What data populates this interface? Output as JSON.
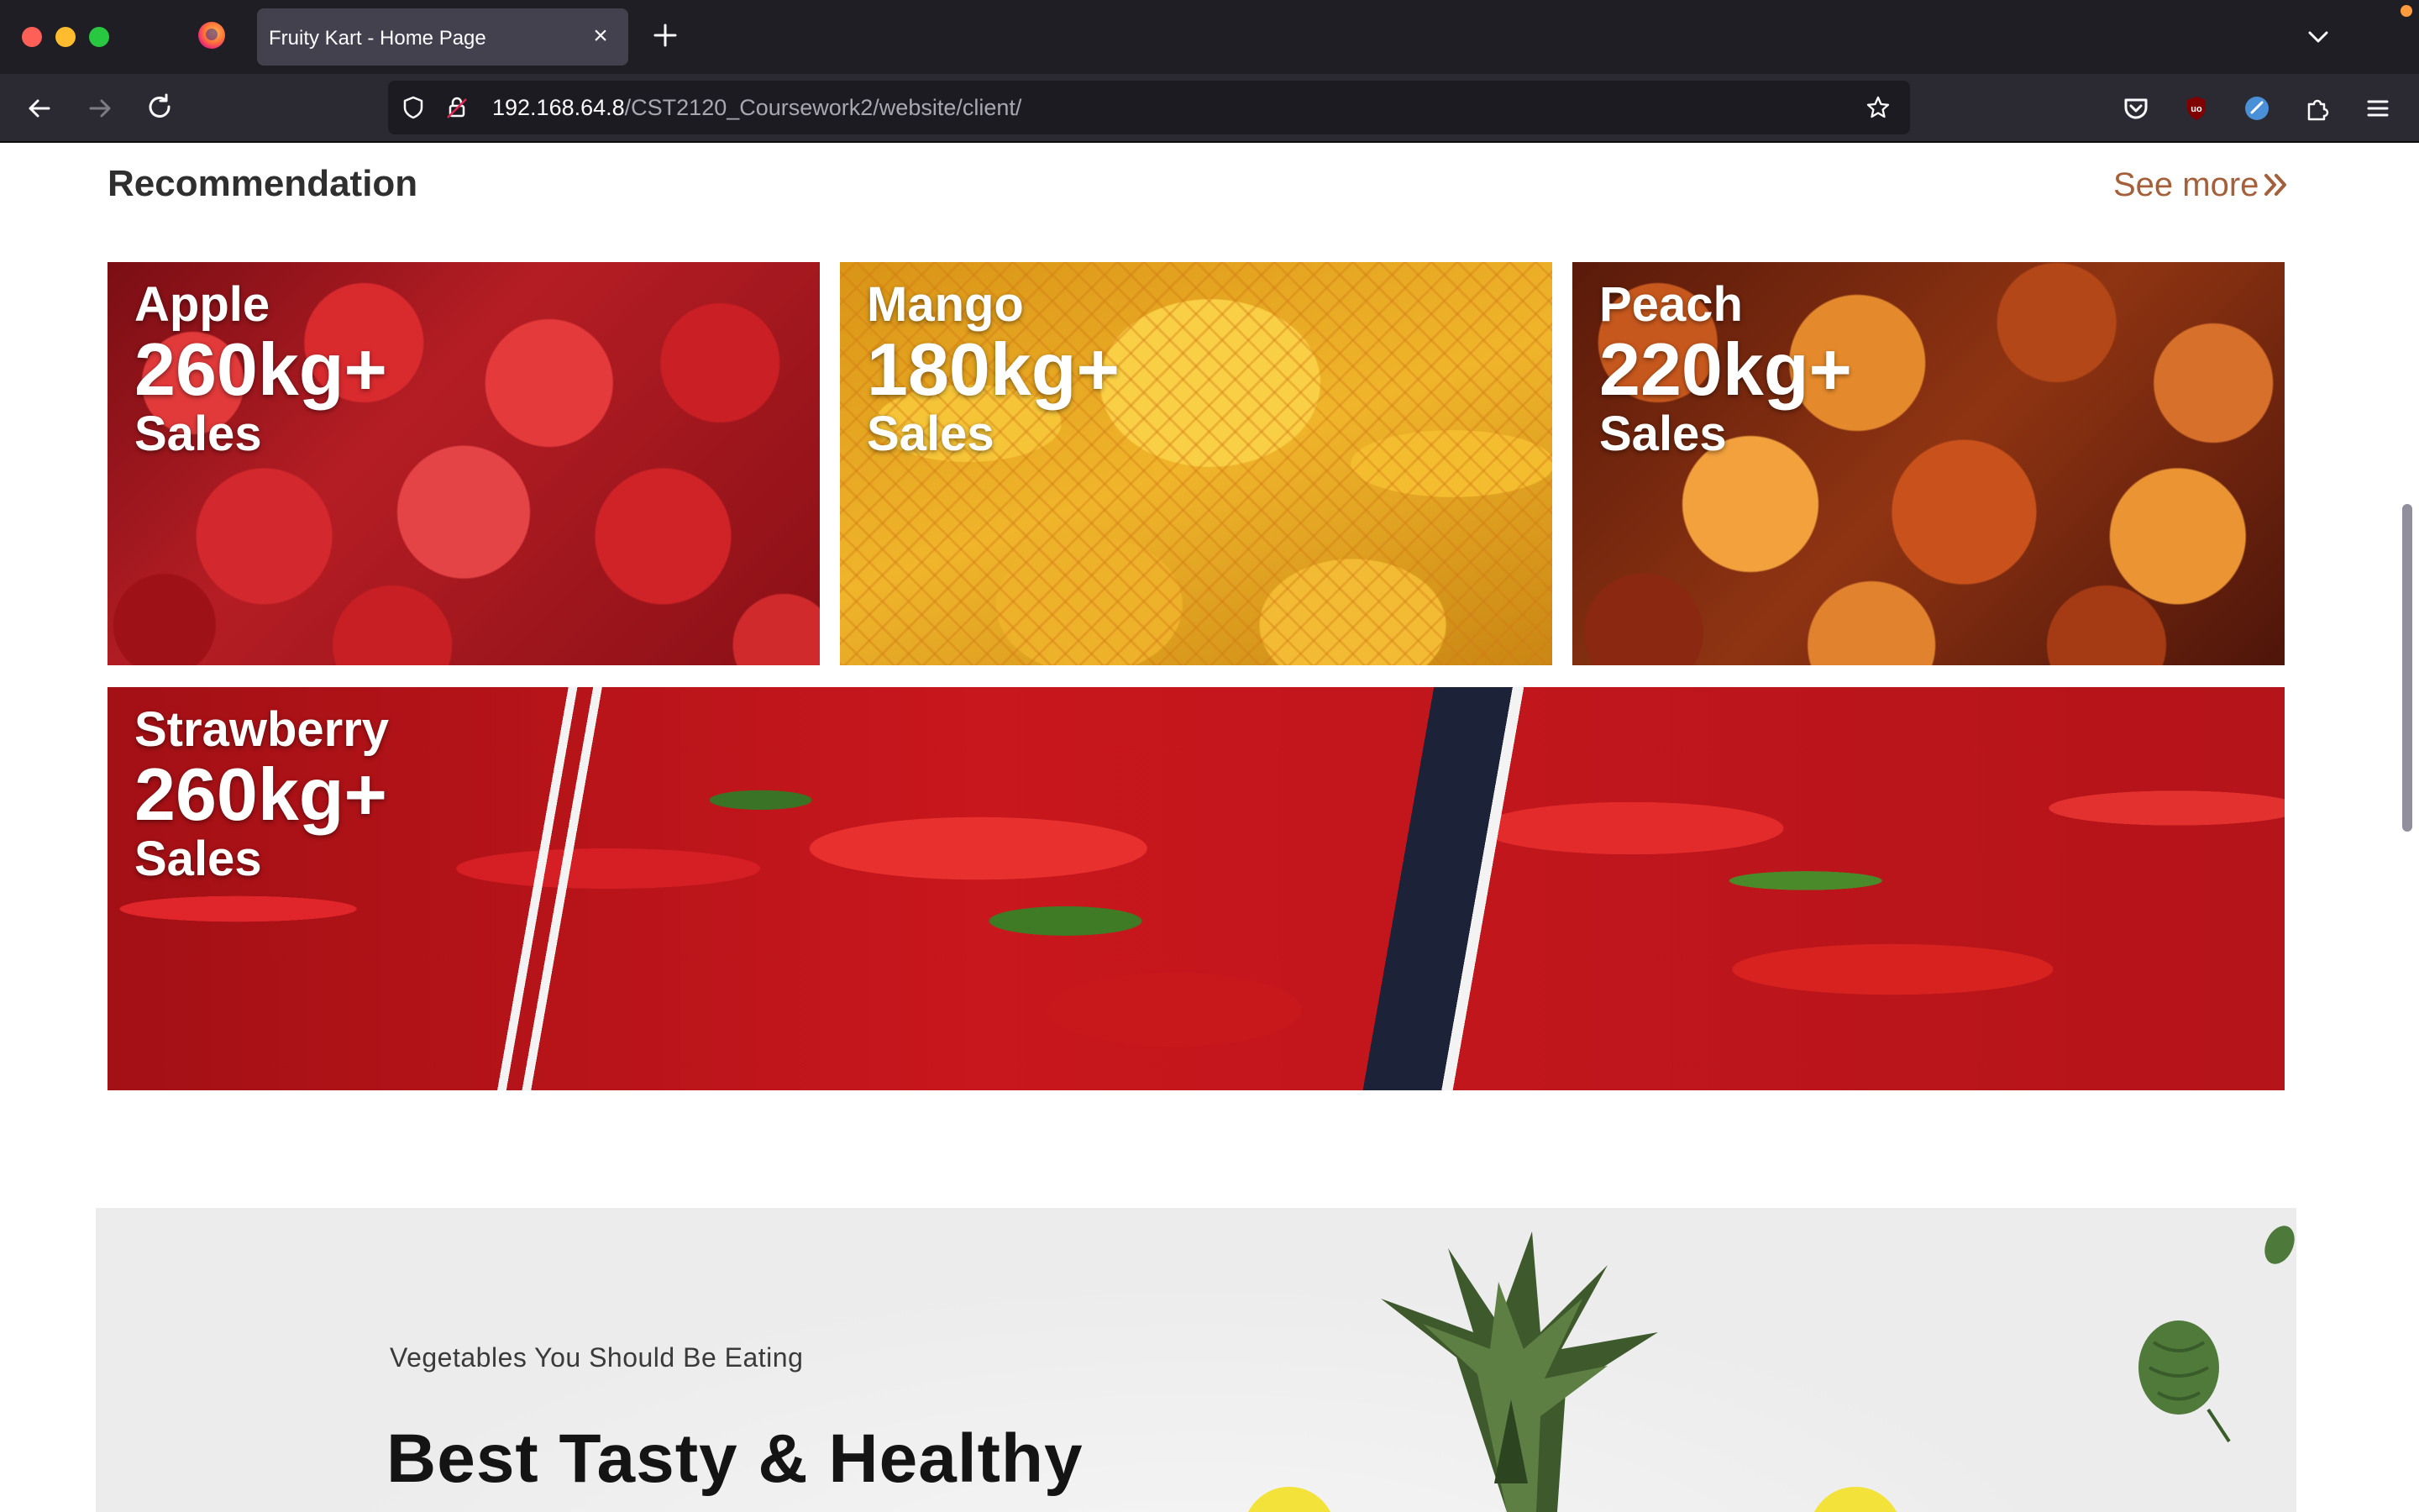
{
  "browser": {
    "tab_title": "Fruity Kart - Home Page",
    "url_host": "192.168.64.8",
    "url_path": "/CST2120_Coursework2/website/client/",
    "icons": [
      "firefox-icon",
      "close-icon",
      "plus-icon",
      "chevron-down-icon",
      "back-arrow-icon",
      "forward-arrow-icon",
      "reload-icon",
      "shield-icon",
      "lock-icon",
      "star-icon",
      "pocket-icon",
      "ublock-icon",
      "extension-blue-icon",
      "puzzle-icon",
      "hamburger-menu-icon"
    ]
  },
  "recommendation": {
    "title": "Recommendation",
    "see_more": "See more",
    "see_more_icon": "double-chevron-right-icon",
    "accent_color": "#a45f3b",
    "cards": [
      {
        "fruit": "Apple",
        "amount": "260kg+",
        "label": "Sales"
      },
      {
        "fruit": "Mango",
        "amount": "180kg+",
        "label": "Sales"
      },
      {
        "fruit": "Peach",
        "amount": "220kg+",
        "label": "Sales"
      },
      {
        "fruit": "Strawberry",
        "amount": "260kg+",
        "label": "Sales"
      }
    ]
  },
  "banner": {
    "subtitle": "Vegetables You Should Be Eating",
    "title": "Best Tasty & Healthy"
  }
}
